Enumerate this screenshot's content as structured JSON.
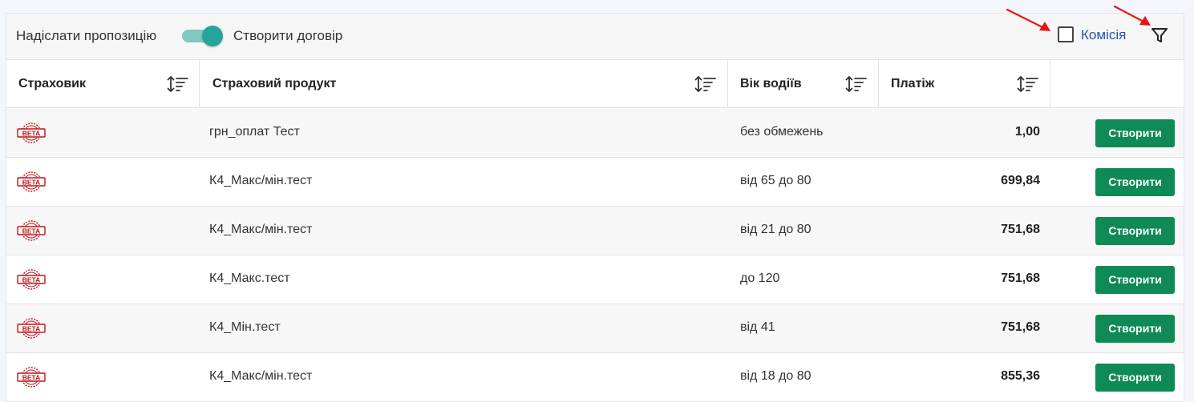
{
  "toolbar": {
    "send_offer_label": "Надіслати пропозицію",
    "create_contract_label": "Створити договір",
    "toggle_on": true,
    "commission_label": "Комісія",
    "commission_checked": false
  },
  "table": {
    "columns": [
      {
        "label": "Страховик"
      },
      {
        "label": "Страховий продукт"
      },
      {
        "label": "Вік водіїв"
      },
      {
        "label": "Платіж"
      }
    ],
    "rows": [
      {
        "insurer_logo": "BETA",
        "product": "грн_оплат Тест",
        "age": "без обмежень",
        "payment": "1,00",
        "action": "Створити"
      },
      {
        "insurer_logo": "BETA",
        "product": "К4_Макс/мін.тест",
        "age": "від 65 до 80",
        "payment": "699,84",
        "action": "Створити"
      },
      {
        "insurer_logo": "BETA",
        "product": "К4_Макс/мін.тест",
        "age": "від 21 до 80",
        "payment": "751,68",
        "action": "Створити"
      },
      {
        "insurer_logo": "BETA",
        "product": "К4_Макс.тест",
        "age": "до 120",
        "payment": "751,68",
        "action": "Створити"
      },
      {
        "insurer_logo": "BETA",
        "product": "К4_Мін.тест",
        "age": "від 41",
        "payment": "751,68",
        "action": "Створити"
      },
      {
        "insurer_logo": "BETA",
        "product": "К4_Макс/мін.тест",
        "age": "від 18 до 80",
        "payment": "855,36",
        "action": "Створити"
      }
    ]
  },
  "colors": {
    "accent_toggle": "#26a69a",
    "create_button": "#0e8a57",
    "link": "#1f5aa6",
    "annotation_arrow": "#e8141a"
  }
}
